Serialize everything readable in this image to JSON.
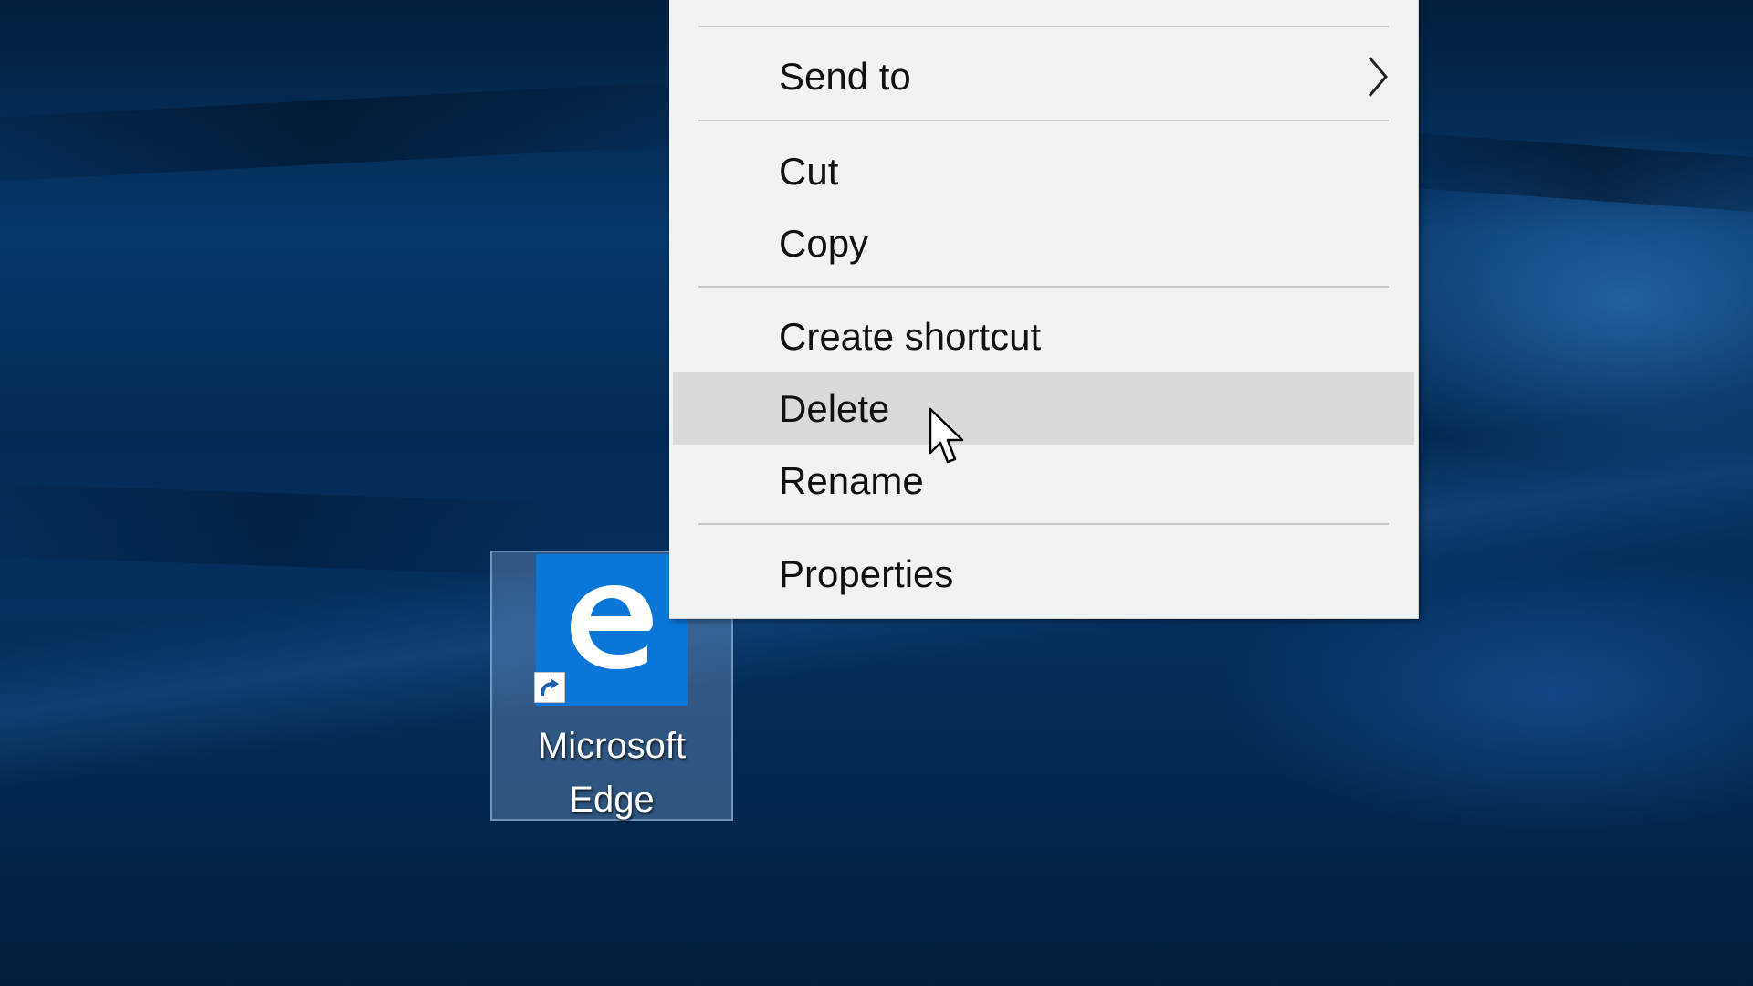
{
  "desktop": {
    "icons": [
      {
        "label_line1": "Microsoft",
        "label_line2": "Edge",
        "icon": "microsoft-edge-icon",
        "badge": "shortcut-arrow-icon",
        "tile_color": "#0a76d8",
        "selected": true
      }
    ]
  },
  "context_menu": {
    "items": [
      {
        "label": "Send to",
        "has_submenu": true
      },
      {
        "label": "Cut"
      },
      {
        "label": "Copy"
      },
      {
        "label": "Create shortcut"
      },
      {
        "label": "Delete",
        "highlighted": true
      },
      {
        "label": "Rename"
      },
      {
        "label": "Properties"
      }
    ],
    "highlight_color": "#dadada",
    "background_color": "#f2f2f2"
  },
  "cursor": {
    "icon": "arrow-cursor-icon"
  }
}
